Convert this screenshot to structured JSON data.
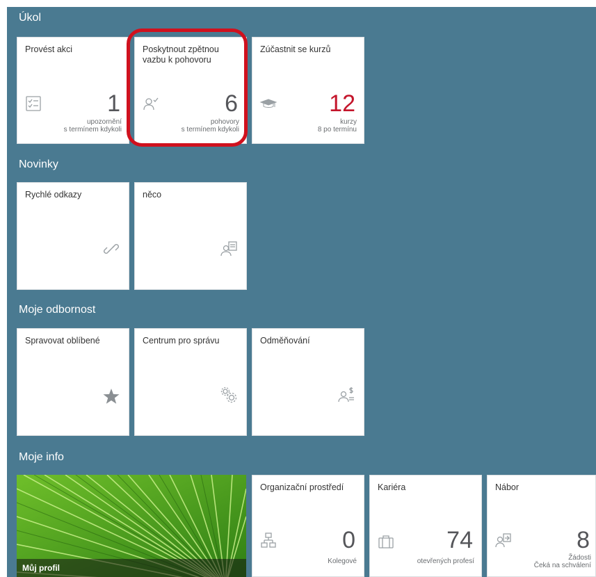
{
  "sections": {
    "ukol": "Úkol",
    "novinky": "Novinky",
    "odbornost": "Moje odbornost",
    "info": "Moje info"
  },
  "tiles": {
    "provest_akci": {
      "title": "Provést akci",
      "number": "1",
      "sub1": "upozornění",
      "sub2": "s termínem kdykoli",
      "icon": "checklist-icon"
    },
    "zpetna_vazba": {
      "title": "Poskytnout zpětnou vazbu k pohovoru",
      "number": "6",
      "sub1": "pohovory",
      "sub2": "s termínem kdykoli",
      "icon": "person-check-icon"
    },
    "kurzy": {
      "title": "Zúčastnit se kurzů",
      "number": "12",
      "number_color": "#c4152b",
      "sub1": "kurzy",
      "sub2": "8 po termínu",
      "icon": "graduation-cap-icon"
    },
    "rychle_odkazy": {
      "title": "Rychlé odkazy",
      "icon": "link-icon"
    },
    "neco": {
      "title": "něco",
      "icon": "person-document-icon"
    },
    "oblibene": {
      "title": "Spravovat oblíbené",
      "icon": "star-icon"
    },
    "centrum": {
      "title": "Centrum pro správu",
      "icon": "gears-icon"
    },
    "odmenovani": {
      "title": "Odměňování",
      "icon": "person-dollar-icon"
    },
    "muj_profil": {
      "title": "Můj profil"
    },
    "org": {
      "title": "Organizační prostředí",
      "number": "0",
      "sub1": "Kolegové",
      "icon": "org-chart-icon"
    },
    "kariera": {
      "title": "Kariéra",
      "number": "74",
      "sub1": "otevřených profesí",
      "icon": "briefcase-icon"
    },
    "nabor": {
      "title": "Nábor",
      "number": "8",
      "sub1": "Žádosti",
      "sub2": "Čeká na schválení",
      "icon": "person-arrow-icon"
    }
  },
  "colors": {
    "background": "#4a7a91",
    "tile": "#ffffff",
    "highlight_ring": "#d0111e",
    "overdue_number": "#c4152b"
  }
}
